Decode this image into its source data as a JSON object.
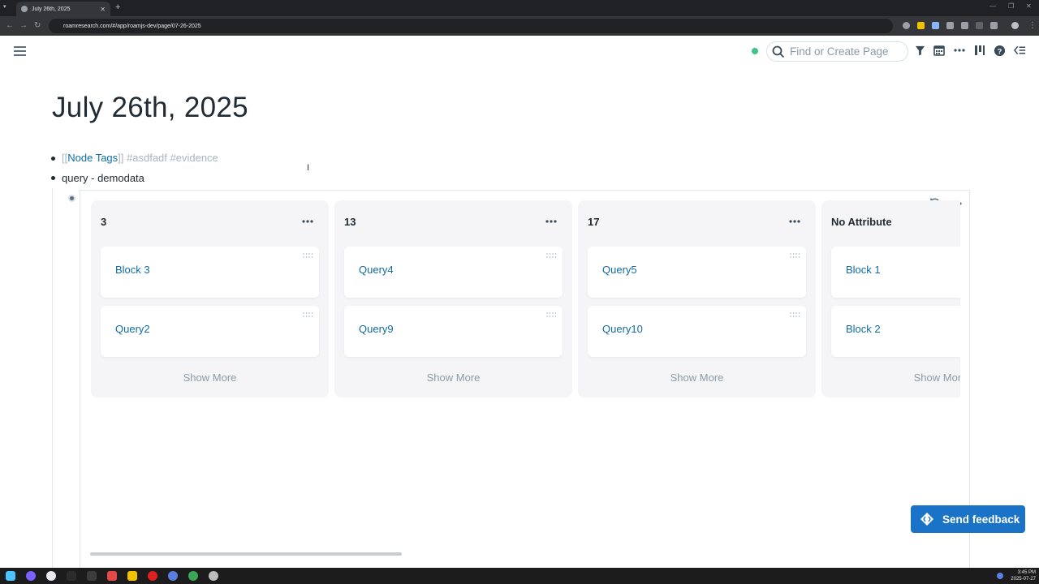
{
  "browser": {
    "tab_title": "July 26th, 2025",
    "url": "roamresearch.com/#/app/roamjs-dev/page/07-26-2025"
  },
  "topbar": {
    "search_placeholder": "Find or Create Page",
    "sync_color": "#3ec487"
  },
  "page": {
    "title": "July 26th, 2025",
    "block1": {
      "open": "[[",
      "link": "Node Tags",
      "close": "]]",
      "tag1": "#asdfadf",
      "tag2": "#evidence"
    },
    "block2": "query - demodata"
  },
  "board": {
    "columns": [
      {
        "title": "3",
        "cards": [
          "Block 3",
          "Query2"
        ],
        "show_more": "Show More"
      },
      {
        "title": "13",
        "cards": [
          "Query4",
          "Query9"
        ],
        "show_more": "Show More"
      },
      {
        "title": "17",
        "cards": [
          "Query5",
          "Query10"
        ],
        "show_more": "Show More"
      },
      {
        "title": "No Attribute",
        "cards": [
          "Block 1",
          "Block 2"
        ],
        "show_more": "Show More"
      }
    ]
  },
  "feedback": {
    "label": "Send feedback",
    "color": "#1a73c7"
  },
  "taskbar": {
    "time": "3:45 PM",
    "date": "2025-07-27"
  }
}
